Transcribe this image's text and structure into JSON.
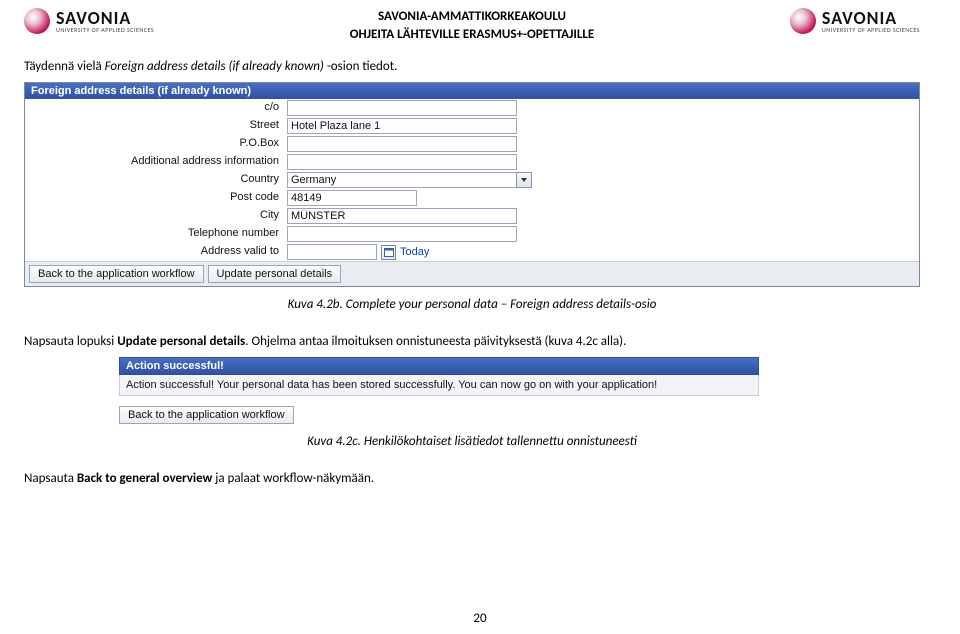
{
  "header": {
    "logo_main": "SAVONIA",
    "logo_sub": "UNIVERSITY OF APPLIED SCIENCES",
    "line1": "SAVONIA-AMMATTIKORKEAKOULU",
    "line2": "OHJEITA LÄHTEVILLE ERASMUS+-OPETTAJILLE"
  },
  "p1": {
    "pre": "Täydennä vielä ",
    "em": "Foreign address details (if already known)",
    "post": " -osion tiedot."
  },
  "form1": {
    "section": "Foreign address details (if already known)",
    "labels": {
      "co": "c/o",
      "street": "Street",
      "pobox": "P.O.Box",
      "addl": "Additional address information",
      "country": "Country",
      "postcode": "Post code",
      "city": "City",
      "phone": "Telephone number",
      "validto": "Address valid to"
    },
    "values": {
      "co": "",
      "street": "Hotel Plaza lane 1",
      "pobox": "",
      "addl": "",
      "country": "Germany",
      "postcode": "48149",
      "city": "MÜNSTER",
      "phone": "",
      "validto": ""
    },
    "today": "Today",
    "btn_back": "Back to the application workflow",
    "btn_update": "Update personal details"
  },
  "caption1": "Kuva 4.2b. Complete your personal data – Foreign address details-osio",
  "p2": {
    "pre": "Napsauta lopuksi ",
    "bold": "Update personal details",
    "post": ". Ohjelma antaa ilmoituksen onnistuneesta päivityksestä (kuva 4.2c alla)."
  },
  "shot2": {
    "hdr": "Action successful!",
    "msg": "Action successful! Your personal data has been stored successfully. You can now go on with your application!",
    "btn": "Back to the application workflow"
  },
  "caption2": "Kuva 4.2c. Henkilökohtaiset lisätiedot tallennettu onnistuneesti",
  "p3": {
    "pre": "Napsauta ",
    "bold": "Back to general overview",
    "post": " ja palaat workflow-näkymään."
  },
  "pagenum": "20"
}
